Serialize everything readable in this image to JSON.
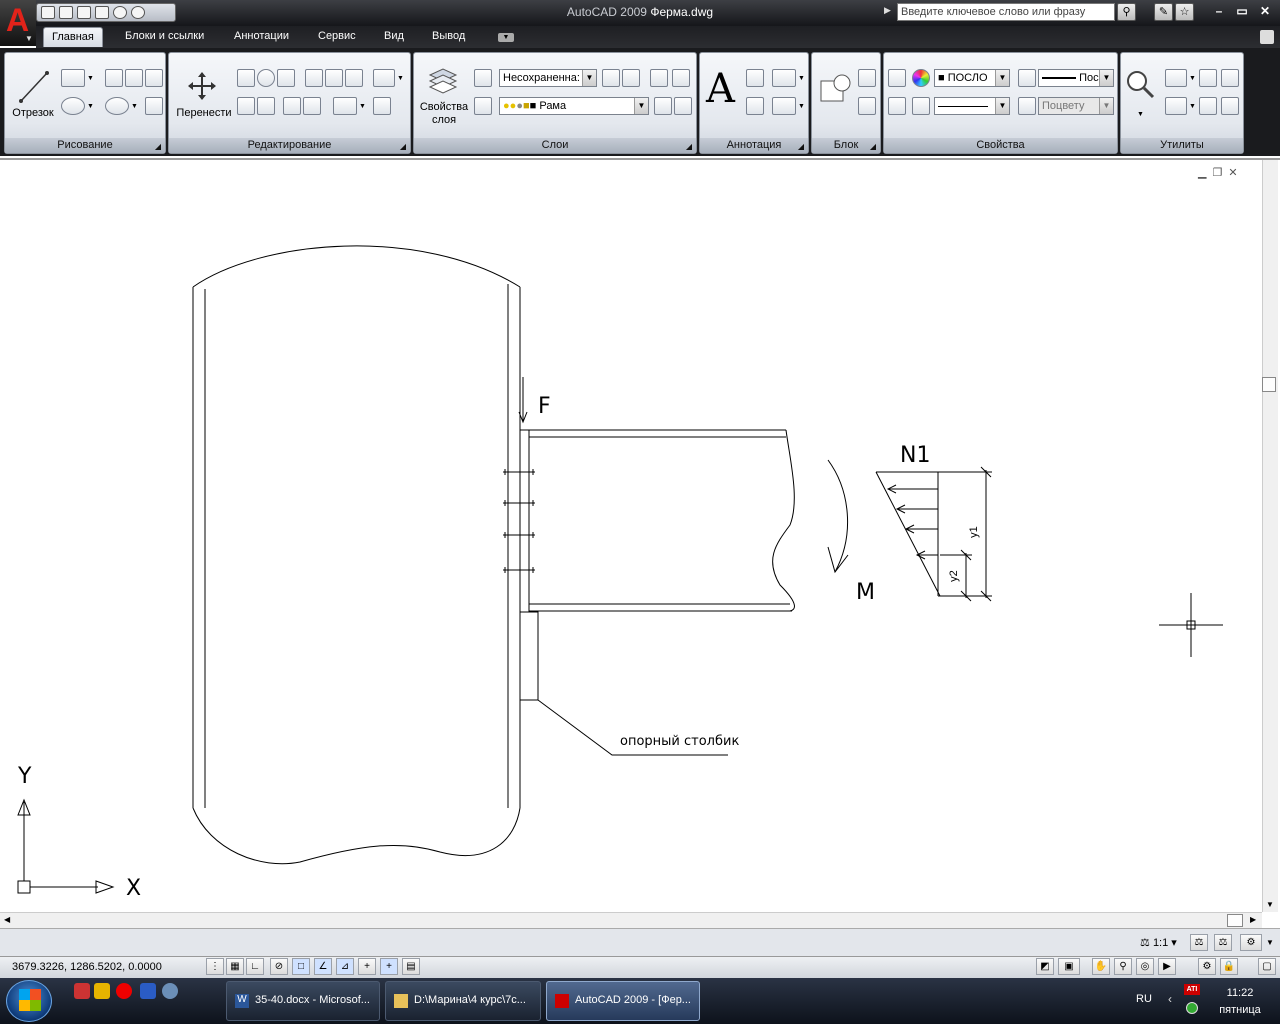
{
  "app": {
    "logo_letter": "A",
    "title_app": "AutoCAD 2009",
    "title_file": "Ферма.dwg",
    "search_placeholder": "Введите ключевое слово или фразу"
  },
  "tabs": [
    "Главная",
    "Блоки и ссылки",
    "Аннотации",
    "Сервис",
    "Вид",
    "Вывод"
  ],
  "ribbon": {
    "draw": {
      "title": "Рисование",
      "line_label": "Отрезок"
    },
    "modify": {
      "title": "Редактирование",
      "move_label": "Перенести"
    },
    "layers": {
      "title": "Слои",
      "props_label": "Свойства слоя",
      "state_value": "Несохраненна:",
      "layer_value": "Рама"
    },
    "annotation": {
      "title": "Аннотация",
      "text_icon_glyph": "A"
    },
    "block": {
      "title": "Блок"
    },
    "properties": {
      "title": "Свойства",
      "color_value": "ПОСЛО",
      "lineweight_value": "Пос",
      "plotstyle_value": "Поцвету"
    },
    "utilities": {
      "title": "Утилиты"
    }
  },
  "drawing": {
    "force_label": "F",
    "n_label": "N1",
    "m_label": "M",
    "y1_label": "y1",
    "y2_label": "y2",
    "leader_label": "опорный столбик",
    "ucs_y": "Y",
    "ucs_x": "X"
  },
  "annotation_scale": "1:1",
  "status": {
    "coords": "3679.3226, 1286.5202, 0.0000"
  },
  "taskbar": {
    "tasks": [
      "35-40.docx - Microsof...",
      "D:\\Марина\\4 курс\\7с...",
      "AutoCAD 2009 - [Фер..."
    ],
    "lang": "RU",
    "time": "11:22",
    "day": "пятница"
  }
}
